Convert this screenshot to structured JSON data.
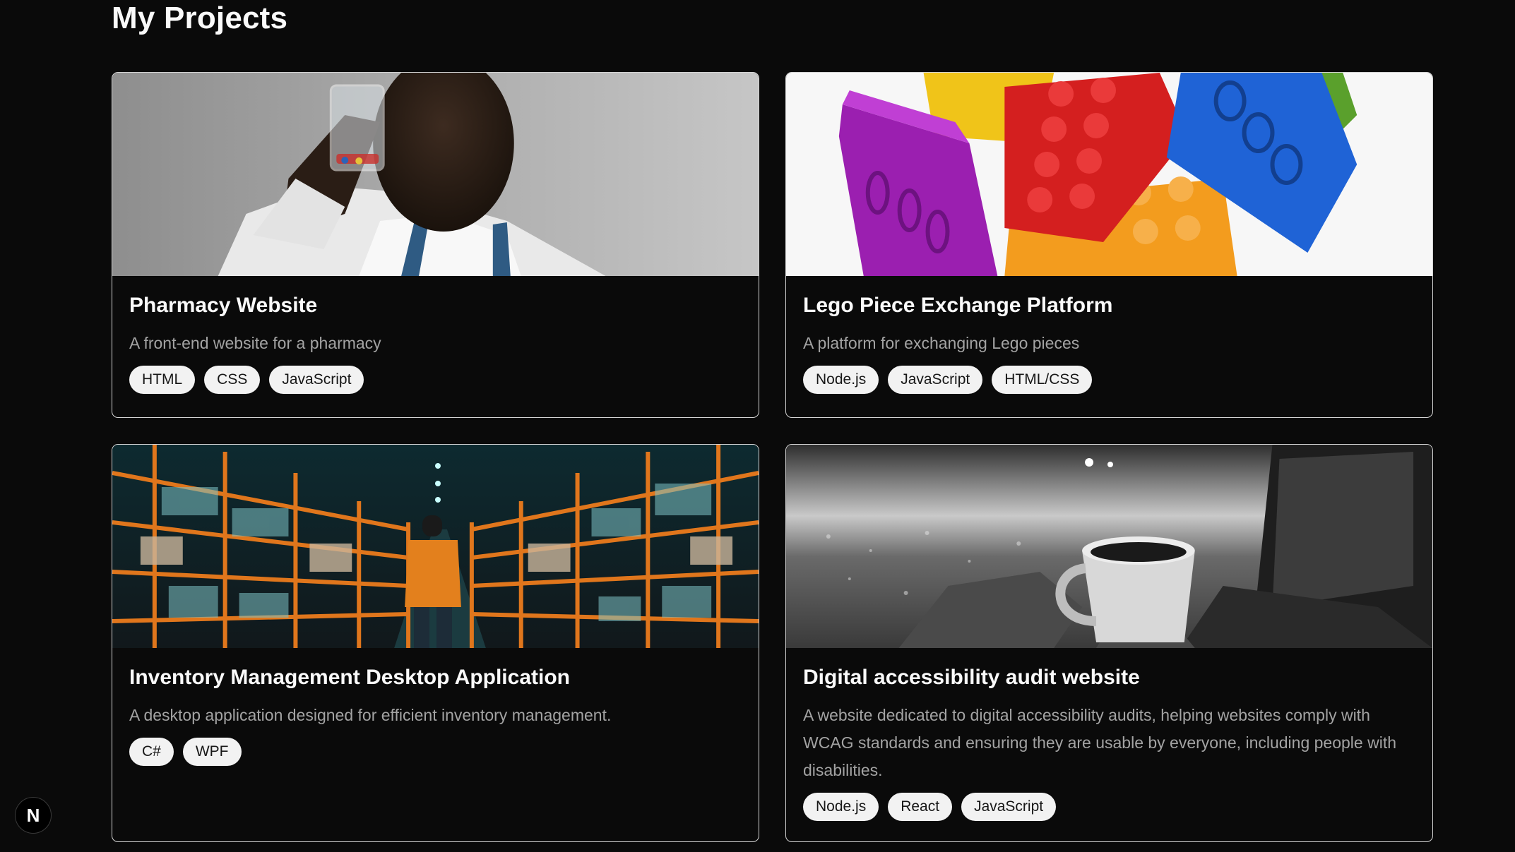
{
  "page": {
    "title": "My Projects"
  },
  "projects": [
    {
      "title": "Pharmacy Website",
      "description": "A front-end website for a pharmacy",
      "tags": [
        "HTML",
        "CSS",
        "JavaScript"
      ],
      "image": "pharmacist-holding-beaker-photo"
    },
    {
      "title": "Lego Piece Exchange Platform",
      "description": "A platform for exchanging Lego pieces",
      "tags": [
        "Node.js",
        "JavaScript",
        "HTML/CSS"
      ],
      "image": "colorful-lego-bricks-photo"
    },
    {
      "title": "Inventory Management Desktop Application",
      "description": "A desktop application designed for efficient inventory management.",
      "tags": [
        "C#",
        "WPF"
      ],
      "image": "warehouse-aisle-worker-photo"
    },
    {
      "title": "Digital accessibility audit website",
      "description": "A website dedicated to digital accessibility audits, helping websites comply with WCAG standards and ensuring they are usable by everyone, including people with disabilities.",
      "tags": [
        "Node.js",
        "React",
        "JavaScript"
      ],
      "image": "coffee-mug-laptop-beach-photo"
    }
  ],
  "dev_badge": {
    "label": "N",
    "icon": "nextjs-icon"
  },
  "colors": {
    "background": "#0a0a0a",
    "card_border": "#d4d4d4",
    "text_primary": "#fafafa",
    "text_muted": "#a3a3a3",
    "tag_bg": "#f2f2f2",
    "tag_text": "#171717"
  }
}
